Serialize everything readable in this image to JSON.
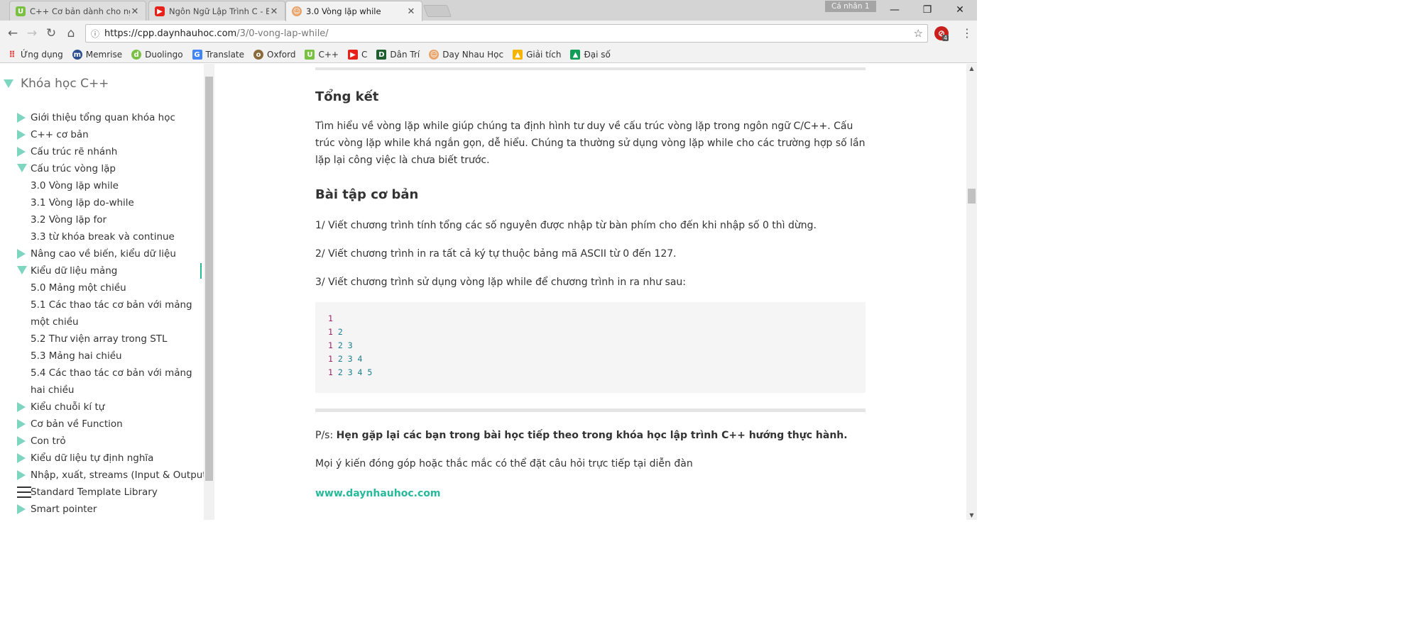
{
  "browser": {
    "tabs": [
      {
        "title": "C++ Cơ bản dành cho người",
        "icon": "udemy-icon",
        "active": false
      },
      {
        "title": "Ngôn Ngữ Lập Trình C - Bài",
        "icon": "youtube-icon",
        "active": false
      },
      {
        "title": "3.0 Vòng lặp while",
        "icon": "daynhauhoc-icon",
        "active": true
      }
    ],
    "profile_label": "Cá nhân 1",
    "url_host": "https://cpp.daynhauhoc.com",
    "url_path": "/3/0-vong-lap-while/",
    "extension_badge": "4",
    "bookmarks": [
      {
        "label": "Ứng dụng",
        "icon": "apps-icon"
      },
      {
        "label": "Memrise",
        "icon": "memrise-icon"
      },
      {
        "label": "Duolingo",
        "icon": "duolingo-icon"
      },
      {
        "label": "Translate",
        "icon": "translate-icon"
      },
      {
        "label": "Oxford",
        "icon": "oxford-icon"
      },
      {
        "label": "C++",
        "icon": "udemy-icon"
      },
      {
        "label": "C",
        "icon": "youtube-icon"
      },
      {
        "label": "Dân Trí",
        "icon": "dantri-icon"
      },
      {
        "label": "Day Nhau Học",
        "icon": "daynhauhoc-icon"
      },
      {
        "label": "Giải tích",
        "icon": "drive-icon"
      },
      {
        "label": "Đại số",
        "icon": "drive-icon"
      }
    ]
  },
  "sidebar": {
    "title": "Khóa học C++",
    "items": [
      {
        "label": "Giới thiệu tổng quan khóa học",
        "type": "collapsed"
      },
      {
        "label": "C++ cơ bản",
        "type": "collapsed"
      },
      {
        "label": "Cấu trúc rẽ nhánh",
        "type": "collapsed"
      },
      {
        "label": "Cấu trúc vòng lặp",
        "type": "expanded"
      },
      {
        "label": "3.0 Vòng lặp while",
        "type": "sub"
      },
      {
        "label": "3.1 Vòng lặp do-while",
        "type": "sub"
      },
      {
        "label": "3.2 Vòng lặp for",
        "type": "sub"
      },
      {
        "label": "3.3 từ khóa break và continue",
        "type": "sub"
      },
      {
        "label": "Nâng cao về biến, kiểu dữ liệu",
        "type": "collapsed"
      },
      {
        "label": "Kiểu dữ liệu mảng",
        "type": "expanded-highlight"
      },
      {
        "label": "5.0 Mảng một chiều",
        "type": "sub"
      },
      {
        "label": "5.1 Các thao tác cơ bản với mảng một chiều",
        "type": "sub"
      },
      {
        "label": "5.2 Thư viện array trong STL",
        "type": "sub"
      },
      {
        "label": "5.3 Mảng hai chiều",
        "type": "sub"
      },
      {
        "label": "5.4 Các thao tác cơ bản với mảng hai chiều",
        "type": "sub"
      },
      {
        "label": "Kiểu chuỗi kí tự",
        "type": "collapsed"
      },
      {
        "label": "Cơ bản về Function",
        "type": "collapsed"
      },
      {
        "label": "Con trỏ",
        "type": "collapsed"
      },
      {
        "label": "Kiểu dữ liệu tự định nghĩa",
        "type": "collapsed"
      },
      {
        "label": "Nhập, xuất, streams (Input & Output)",
        "type": "collapsed"
      },
      {
        "label": "Standard Template Library",
        "type": "hamburger"
      },
      {
        "label": "Smart pointer",
        "type": "collapsed"
      }
    ]
  },
  "article": {
    "summary_heading": "Tổng kết",
    "summary_text": "Tìm hiểu về vòng lặp while giúp chúng ta định hình tư duy về cấu trúc vòng lặp trong ngôn ngữ C/C++. Cấu trúc vòng lặp while khá ngắn gọn, dễ hiểu. Chúng ta thường sử dụng vòng lặp while cho các trường hợp số lần lặp lại công việc là chưa biết trước.",
    "exercises_heading": "Bài tập cơ bản",
    "exercise_1": "1/ Viết chương trình tính tổng các số nguyên được nhập từ bàn phím cho đến khi nhập số 0 thì dừng.",
    "exercise_2": "2/ Viết chương trình in ra tất cả ký tự thuộc bảng mã ASCII từ 0 đến 127.",
    "exercise_3": "3/ Viết chương trình sử dụng vòng lặp while để chương trình in ra như sau:",
    "code_lines": [
      {
        "first": "1",
        "rest": ""
      },
      {
        "first": "1",
        "rest": " 2"
      },
      {
        "first": "1",
        "rest": " 2 3"
      },
      {
        "first": "1",
        "rest": " 2 3 4"
      },
      {
        "first": "1",
        "rest": " 2 3 4 5"
      }
    ],
    "ps_prefix": "P/s: ",
    "ps_bold": "Hẹn gặp lại các bạn trong bài học tiếp theo trong khóa học lập trình C++ hướng thực hành.",
    "feedback": "Mọi ý kiến đóng góp hoặc thắc mắc có thể đặt câu hỏi trực tiếp tại diễn đàn",
    "site_link": "www.daynhauhoc.com"
  },
  "colors": {
    "accent": "#26b99a",
    "triangle": "#7cd6c0",
    "code_first": "#a41f6a",
    "code_rest": "#1a7f8f"
  }
}
